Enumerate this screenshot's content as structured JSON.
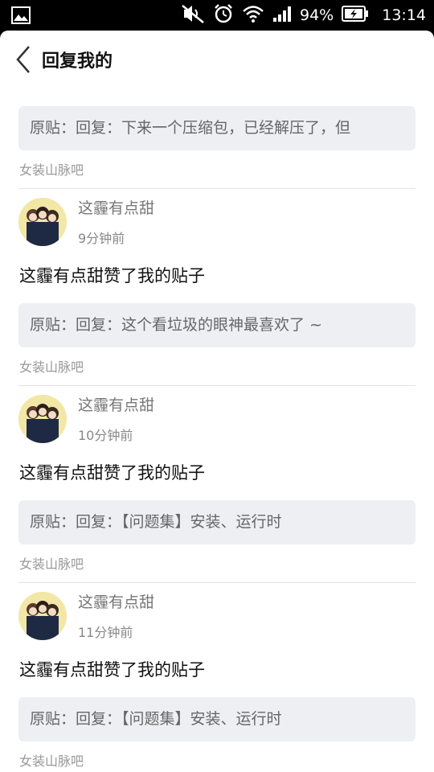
{
  "status_bar": {
    "battery_percent": "94%",
    "time": "13:14",
    "icons": [
      "image-icon",
      "mute-icon",
      "alarm-icon",
      "wifi-icon",
      "signal-icon",
      "battery-charging-icon"
    ]
  },
  "header": {
    "title": "回复我的"
  },
  "top_partial": {
    "quote": "原贴：回复：下来一个压缩包，已经解压了，但",
    "forum": "女装山脉吧"
  },
  "items": [
    {
      "username": "这霾有点甜",
      "time_ago": "9分钟前",
      "action": "这霾有点甜赞了我的贴子",
      "quote": "原贴：回复：这个看垃圾的眼神最喜欢了 ~",
      "forum": "女装山脉吧"
    },
    {
      "username": "这霾有点甜",
      "time_ago": "10分钟前",
      "action": "这霾有点甜赞了我的贴子",
      "quote": "原贴：回复：【问题集】安装、运行时",
      "forum": "女装山脉吧"
    },
    {
      "username": "这霾有点甜",
      "time_ago": "11分钟前",
      "action": "这霾有点甜赞了我的贴子",
      "quote": "原贴：回复：【问题集】安装、运行时",
      "forum": "女装山脉吧"
    }
  ]
}
